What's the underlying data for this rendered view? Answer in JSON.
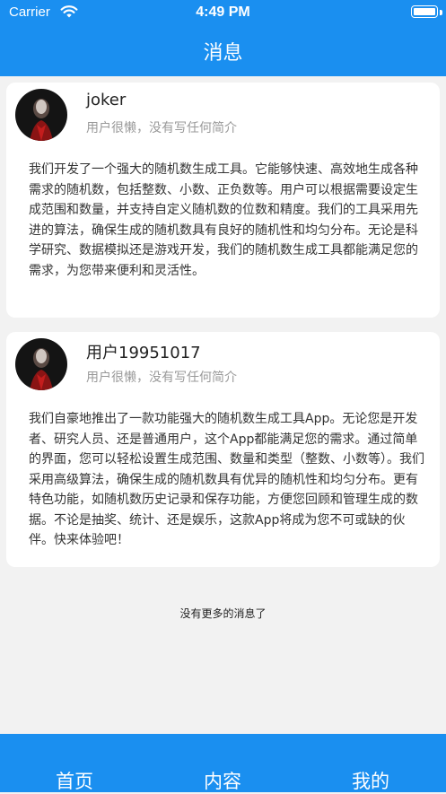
{
  "status_bar": {
    "carrier": "Carrier",
    "time": "4:49 PM"
  },
  "nav": {
    "title": "消息"
  },
  "posts": [
    {
      "author": "joker",
      "bio": "用户很懒，没有写任何简介",
      "body": "我们开发了一个强大的随机数生成工具。它能够快速、高效地生成各种需求的随机数，包括整数、小数、正负数等。用户可以根据需要设定生成范围和数量，并支持自定义随机数的位数和精度。我们的工具采用先进的算法，确保生成的随机数具有良好的随机性和均匀分布。无论是科学研究、数据模拟还是游戏开发，我们的随机数生成工具都能满足您的需求，为您带来便利和灵活性。"
    },
    {
      "author": "用户19951017",
      "bio": "用户很懒，没有写任何简介",
      "body": "我们自豪地推出了一款功能强大的随机数生成工具App。无论您是开发者、研究人员、还是普通用户，这个App都能满足您的需求。通过简单的界面，您可以轻松设置生成范围、数量和类型（整数、小数等）。我们采用高级算法，确保生成的随机数具有优异的随机性和均匀分布。更有特色功能，如随机数历史记录和保存功能，方便您回顾和管理生成的数据。不论是抽奖、统计、还是娱乐，这款App将成为您不可或缺的伙伴。快来体验吧！"
    }
  ],
  "feed_end": "没有更多的消息了",
  "tabs": [
    {
      "label": "首页"
    },
    {
      "label": "内容"
    },
    {
      "label": "我的"
    }
  ],
  "colors": {
    "brand": "#1a8ff0",
    "background": "#f2f2f2",
    "card": "#ffffff",
    "muted_text": "#999999"
  }
}
